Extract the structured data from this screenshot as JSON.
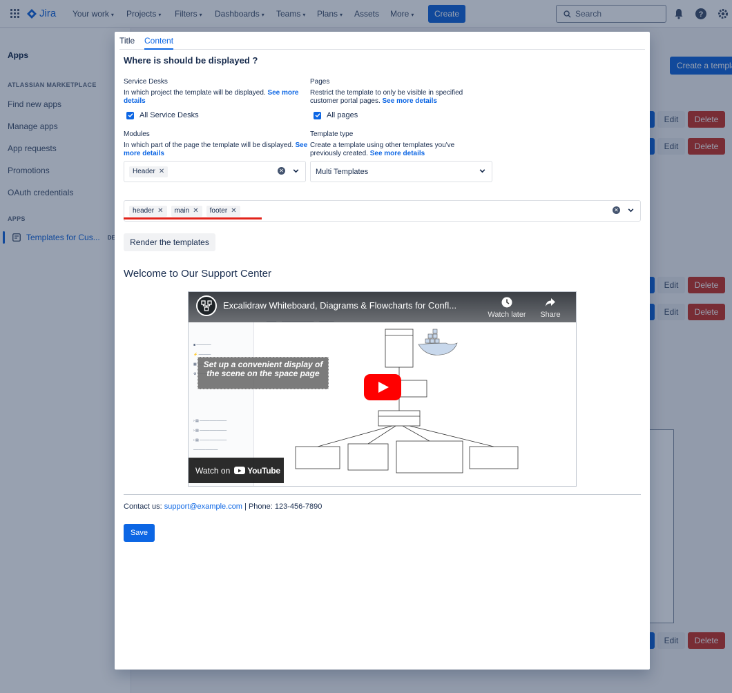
{
  "nav": {
    "logo": "Jira",
    "items": [
      "Your work",
      "Projects",
      "Filters",
      "Dashboards",
      "Teams",
      "Plans",
      "Assets",
      "More"
    ],
    "create": "Create",
    "search_placeholder": "Search"
  },
  "sidebar": {
    "title": "Apps",
    "section_marketplace": "ATLASSIAN MARKETPLACE",
    "items": [
      "Find new apps",
      "Manage apps",
      "App requests",
      "Promotions",
      "OAuth credentials"
    ],
    "section_apps": "APPS",
    "active_item": "Templates for Cus...",
    "active_badge": "DE"
  },
  "background": {
    "create_template": "Create a template",
    "edit": "Edit",
    "delete": "Delete"
  },
  "modal": {
    "tabs": [
      "Title",
      "Content"
    ],
    "active_tab": "Content",
    "heading": "Where is should be displayed ?",
    "service_desks": {
      "label": "Service Desks",
      "desc": "In which project the template will be displayed.",
      "link": "See more details",
      "checkbox": "All Service Desks"
    },
    "pages": {
      "label": "Pages",
      "desc": "Restrict the template to only be visible in specified customer portal pages.",
      "link": "See more details",
      "checkbox": "All pages"
    },
    "modules": {
      "label": "Modules",
      "desc": "In which part of the page the template will be displayed.",
      "link": "See more details",
      "tags": [
        "Header"
      ]
    },
    "template_type": {
      "label": "Template type",
      "desc": "Create a template using other templates you've previously created.",
      "link": "See more details",
      "value": "Multi Templates"
    },
    "templates_select": {
      "tags": [
        "header",
        "main",
        "footer"
      ]
    },
    "render_button": "Render the templates",
    "preview": {
      "heading": "Welcome to Our Support Center",
      "video": {
        "title": "Excalidraw Whiteboard, Diagrams & Flowcharts for Confl...",
        "watch_later": "Watch later",
        "share": "Share",
        "caption": "Set up a convenient display of the scene on the space page",
        "watch_on": "Watch on",
        "youtube": "YouTube"
      },
      "contact_prefix": "Contact us: ",
      "contact_email": "support@example.com",
      "contact_phone": " | Phone: 123-456-7890"
    },
    "save": "Save"
  }
}
